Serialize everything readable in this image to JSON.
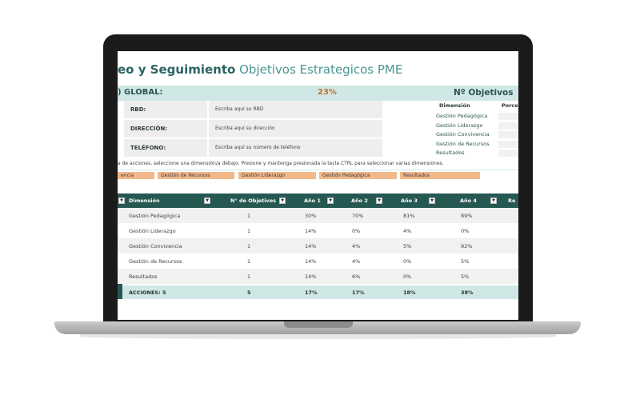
{
  "title": {
    "bold": "eo y Seguimiento",
    "thin": "Objetivos Estrategicos PME"
  },
  "band": {
    "global_label": ") GLOBAL:",
    "global_value": "23%",
    "objectives_label": "Nº Objetivos"
  },
  "info": [
    {
      "label": "RBD:",
      "placeholder": "Escriba aquí su RBD"
    },
    {
      "label": "DIRECCIÓN:",
      "placeholder": "Escriba aquí su dirección"
    },
    {
      "label": "TELÉFONO:",
      "placeholder": "Escriba aquí su número de teléfono"
    }
  ],
  "summary": {
    "dim_header": "Dimensión",
    "porc_header": "Porcen",
    "items": [
      "Gestión Pedagógica",
      "Gestión Liderazgo",
      "Gestión Convivencia",
      "Gestión de Recursos",
      "Resultados"
    ]
  },
  "instructions": "a de acciones, seleccione una dimensión/a debajo. Presione y mantenga presionada la tecla CTRL para seleccionar varias dimensiones.",
  "chips": [
    "encia",
    "Gestión de Recursos",
    "Gestión Liderazgo",
    "Gestión Pedagógica",
    "Resultados"
  ],
  "table": {
    "headers": [
      "Dimensión",
      "N° de Objetivos",
      "Año 1",
      "Año 2",
      "Año 3",
      "Año 4",
      "Re"
    ],
    "rows": [
      [
        "Gestión Pedagógica",
        "1",
        "30%",
        "70%",
        "81%",
        "89%"
      ],
      [
        "Gestión Liderazgo",
        "1",
        "14%",
        "0%",
        "4%",
        "0%"
      ],
      [
        "Gestión Convivencia",
        "1",
        "14%",
        "4%",
        "5%",
        "92%"
      ],
      [
        "Gestión de Recursos",
        "1",
        "14%",
        "4%",
        "0%",
        "5%"
      ],
      [
        "Resultados",
        "1",
        "14%",
        "6%",
        "0%",
        "5%"
      ]
    ],
    "total": [
      "ACCIONES: 5",
      "5",
      "17%",
      "17%",
      "18%",
      "38%"
    ]
  },
  "colors": {
    "header": "#265853",
    "band": "#cfe8e6",
    "chip": "#f2b88a",
    "accent": "#c1702a"
  }
}
